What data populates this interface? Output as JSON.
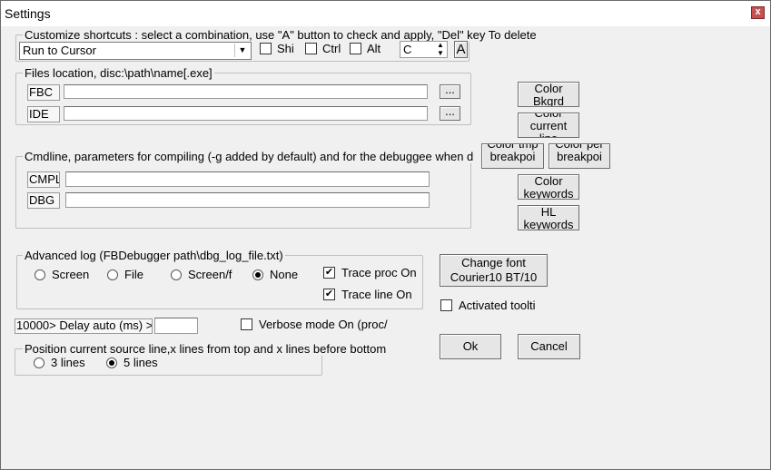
{
  "window": {
    "title": "Settings",
    "close_glyph": "x"
  },
  "shortcuts": {
    "group_label": "Customize shortcuts : select a combination, use \"A\" button to check and apply, \"Del\" key To delete",
    "combo_value": "Run to Cursor",
    "shift_label": "Shi",
    "ctrl_label": "Ctrl",
    "alt_label": "Alt",
    "key_value": "C",
    "apply_label": "A"
  },
  "files": {
    "group_label": "Files location, disc:\\path\\name[.exe]",
    "fbc_tag": "FBC",
    "fbc_value": "",
    "ide_tag": "IDE",
    "ide_value": "",
    "browse_label": "..."
  },
  "cmdline": {
    "group_label": "Cmdline, parameters for compiling (-g added by default) and for the debuggee when d",
    "cmpl_tag": "CMPL",
    "cmpl_value": "",
    "dbg_tag": "DBG",
    "dbg_value": ""
  },
  "color_buttons": {
    "bkgrd": [
      "Color",
      "Bkgrd"
    ],
    "current": [
      "Color",
      "current",
      "line"
    ],
    "tmp": [
      "Color tmp",
      "breakpoi"
    ],
    "per": [
      "Color per",
      "breakpoi"
    ],
    "keywords": [
      "Color",
      "keywords"
    ],
    "hl": [
      "HL",
      "keywords"
    ]
  },
  "log": {
    "group_label": "Advanced log (FBDebugger path\\dbg_log_file.txt)",
    "screen": "Screen",
    "file": "File",
    "screen_file": "Screen/f",
    "none": "None",
    "trace_proc": "Trace proc On",
    "trace_line": "Trace line On",
    "selected": "None",
    "trace_proc_checked": true,
    "trace_line_checked": true
  },
  "font": {
    "change_label": "Change font",
    "font_name": "Courier10 BT/10"
  },
  "tooltips_label": "Activated toolti",
  "delay": {
    "tag": "10000> Delay auto (ms) >",
    "value": ""
  },
  "verbose_label": "Verbose mode On (proc/",
  "position": {
    "group_label": "Position current source line,x lines from top and x lines before bottom",
    "opt3": "3 lines",
    "opt5": "5 lines",
    "selected": "5 lines"
  },
  "ok_label": "Ok",
  "cancel_label": "Cancel"
}
